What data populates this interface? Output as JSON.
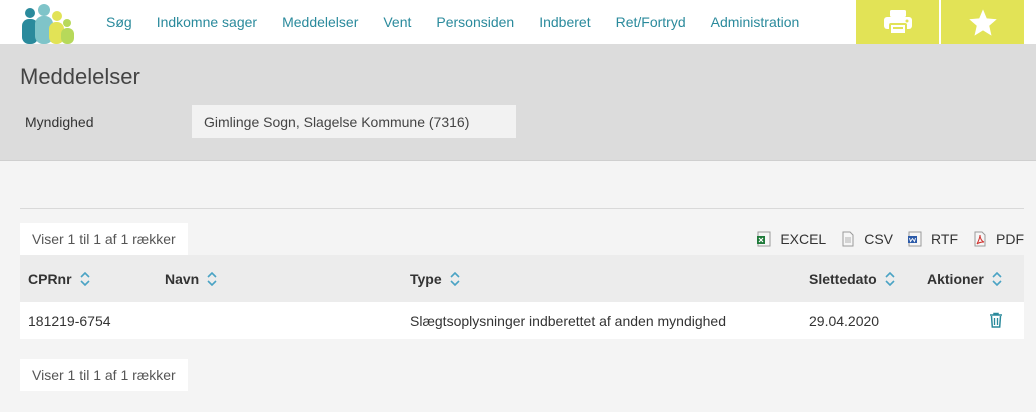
{
  "nav": {
    "items": [
      "Søg",
      "Indkomne sager",
      "Meddelelser",
      "Vent",
      "Personsiden",
      "Indberet",
      "Ret/Fortryd",
      "Administration"
    ],
    "print_icon": "printer-icon",
    "star_icon": "star-icon"
  },
  "colors": {
    "accent": "#e2e356",
    "link": "#2a8a9c",
    "header_bg": "#dcdcdc"
  },
  "page": {
    "title": "Meddelelser",
    "authority_label": "Myndighed",
    "authority_value": "Gimlinge Sogn, Slagelse Kommune (7316)"
  },
  "pager": {
    "top_info": "Viser 1 til 1 af 1 rækker",
    "bottom_info": "Viser 1 til 1 af 1 rækker"
  },
  "exports": {
    "excel": "EXCEL",
    "csv": "CSV",
    "rtf": "RTF",
    "pdf": "PDF"
  },
  "table": {
    "headers": {
      "cpr": "CPRnr",
      "name": "Navn",
      "type": "Type",
      "delete_date": "Slettedato",
      "actions": "Aktioner"
    },
    "rows": [
      {
        "cpr": "181219-6754",
        "name": "",
        "type": "Slægtsoplysninger indberettet af anden myndighed",
        "delete_date": "29.04.2020",
        "action_icon": "trash-icon"
      }
    ]
  }
}
